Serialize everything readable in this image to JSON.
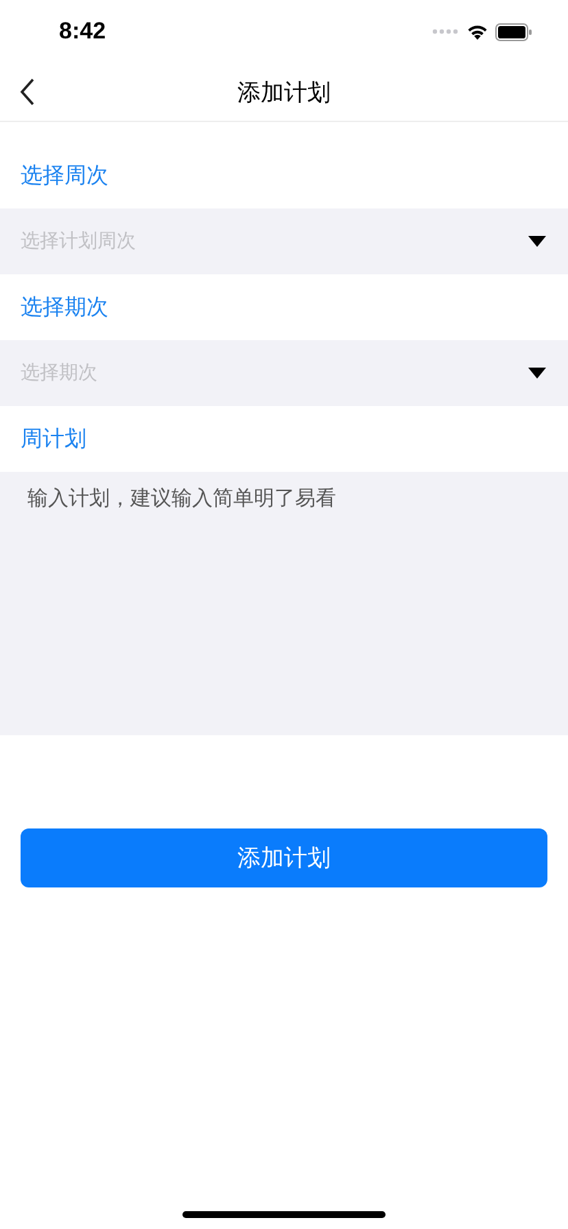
{
  "status_bar": {
    "time": "8:42"
  },
  "nav": {
    "title": "添加计划"
  },
  "fields": [
    {
      "label": "选择周次",
      "kind": "select",
      "placeholder": "选择计划周次"
    },
    {
      "label": "选择期次",
      "kind": "select",
      "placeholder": "选择期次"
    },
    {
      "label": "周计划",
      "kind": "textarea",
      "placeholder": "输入计划，建议输入简单明了易看"
    }
  ],
  "submit_button": {
    "label": "添加计划"
  }
}
